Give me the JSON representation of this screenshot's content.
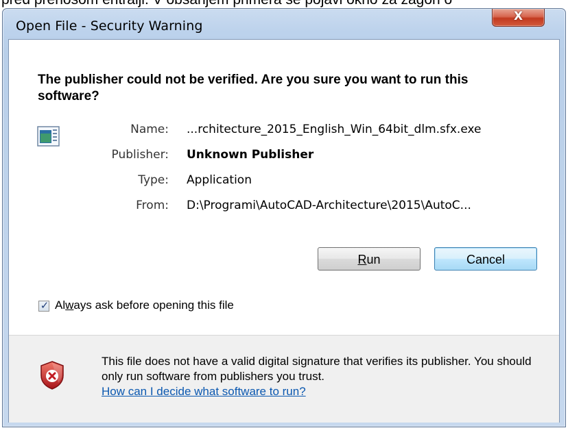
{
  "background_text": "pred prenosom entralji. V obsanjem primera se pojavi okno za zagon o",
  "window": {
    "title": "Open File - Security Warning",
    "close_glyph": "X"
  },
  "dialog": {
    "heading": "The publisher could not be verified.  Are you sure you want to run this software?",
    "fields": {
      "name_label": "Name:",
      "name_value": "...rchitecture_2015_English_Win_64bit_dlm.sfx.exe",
      "publisher_label": "Publisher:",
      "publisher_value": "Unknown Publisher",
      "type_label": "Type:",
      "type_value": "Application",
      "from_label": "From:",
      "from_value": "D:\\Programi\\AutoCAD-Architecture\\2015\\AutoC..."
    },
    "buttons": {
      "run_underlined": "R",
      "run_rest": "un",
      "cancel": "Cancel"
    },
    "checkbox": {
      "checked": true,
      "label_pre": "Al",
      "label_underlined": "w",
      "label_post": "ays ask before opening this file"
    },
    "warning": {
      "text": "This file does not have a valid digital signature that verifies its publisher.  You should only run software from publishers you trust.",
      "link": "How can I decide what software to run?"
    }
  },
  "icons": {
    "app": "application-icon",
    "shield": "security-shield-error-icon",
    "check": "checkmark-icon"
  },
  "colors": {
    "link": "#0b58b0",
    "close_button": "#c23a20",
    "default_button_border": "#3c7fb1"
  }
}
